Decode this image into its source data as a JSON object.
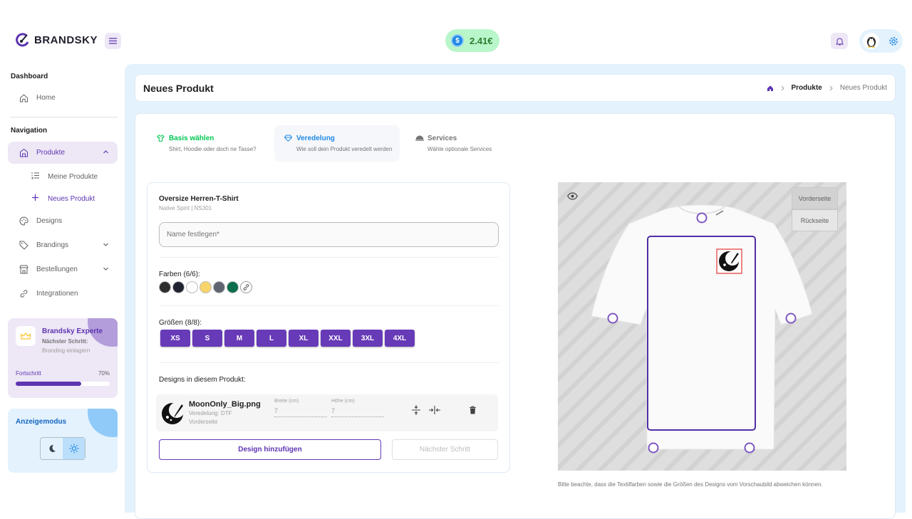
{
  "app": {
    "name": "BRANDSKY"
  },
  "header": {
    "balance": "2.41€"
  },
  "sidebar": {
    "section_dashboard": "Dashboard",
    "home": "Home",
    "section_navigation": "Navigation",
    "produkte": "Produkte",
    "meine_produkte": "Meine Produkte",
    "neues_produkt": "Neues Produkt",
    "designs": "Designs",
    "brandings": "Brandings",
    "bestellungen": "Bestellungen",
    "integrationen": "Integrationen",
    "expert": {
      "title": "Brandsky Experte",
      "next_label": "Nächster Schritt:",
      "next_task": "Branding einlagern",
      "progress_label": "Fortschritt",
      "progress_text": "70%",
      "progress_value": 0.7
    },
    "display_mode": {
      "title": "Anzeigemodus",
      "selected": "light"
    }
  },
  "page": {
    "title": "Neues Produkt",
    "breadcrumb": [
      "Produkte",
      "Neues Produkt"
    ]
  },
  "steps": [
    {
      "title": "Basis wählen",
      "subtitle": "Shirt, Hoodie oder doch ne Tasse?",
      "color": "#00c853"
    },
    {
      "title": "Veredelung",
      "subtitle": "Wie soll dein Produkt veredelt werden",
      "color": "#1e88e5"
    },
    {
      "title": "Services",
      "subtitle": "Wähle optionale Services",
      "color": "#757575"
    }
  ],
  "product": {
    "name": "Oversize Herren-T-Shirt",
    "sub": "Native Spirit | NS301",
    "name_placeholder": "Name festlegen*"
  },
  "colors": {
    "label": "Farben (6/6):",
    "swatches": [
      "#2e2e2e",
      "#1f2330",
      "#ffffff",
      "#f9d46b",
      "#5f6470",
      "#0b6e4f"
    ]
  },
  "sizes": {
    "label": "Größen (8/8):",
    "items": [
      "XS",
      "S",
      "M",
      "L",
      "XL",
      "XXL",
      "3XL",
      "4XL"
    ]
  },
  "designs": {
    "label": "Designs in diesem Produkt:",
    "items": [
      {
        "file": "MoonOnly_Big.png",
        "veredelung": "Veredelung: DTF",
        "side": "Vorderseite",
        "width_label": "Breite (cm)",
        "width": "7",
        "height_label": "Höhe (cm)",
        "height": "7"
      }
    ]
  },
  "buttons": {
    "add_design": "Design hinzufügen",
    "next_step": "Nächster Schritt"
  },
  "preview": {
    "front": "Vorderseite",
    "back": "Rückseite",
    "note": "Bitte beachte, dass die Textilfarben sowie die Größen des Designs vom Vorschaubild abweichen können."
  },
  "accent": "#673ab7"
}
